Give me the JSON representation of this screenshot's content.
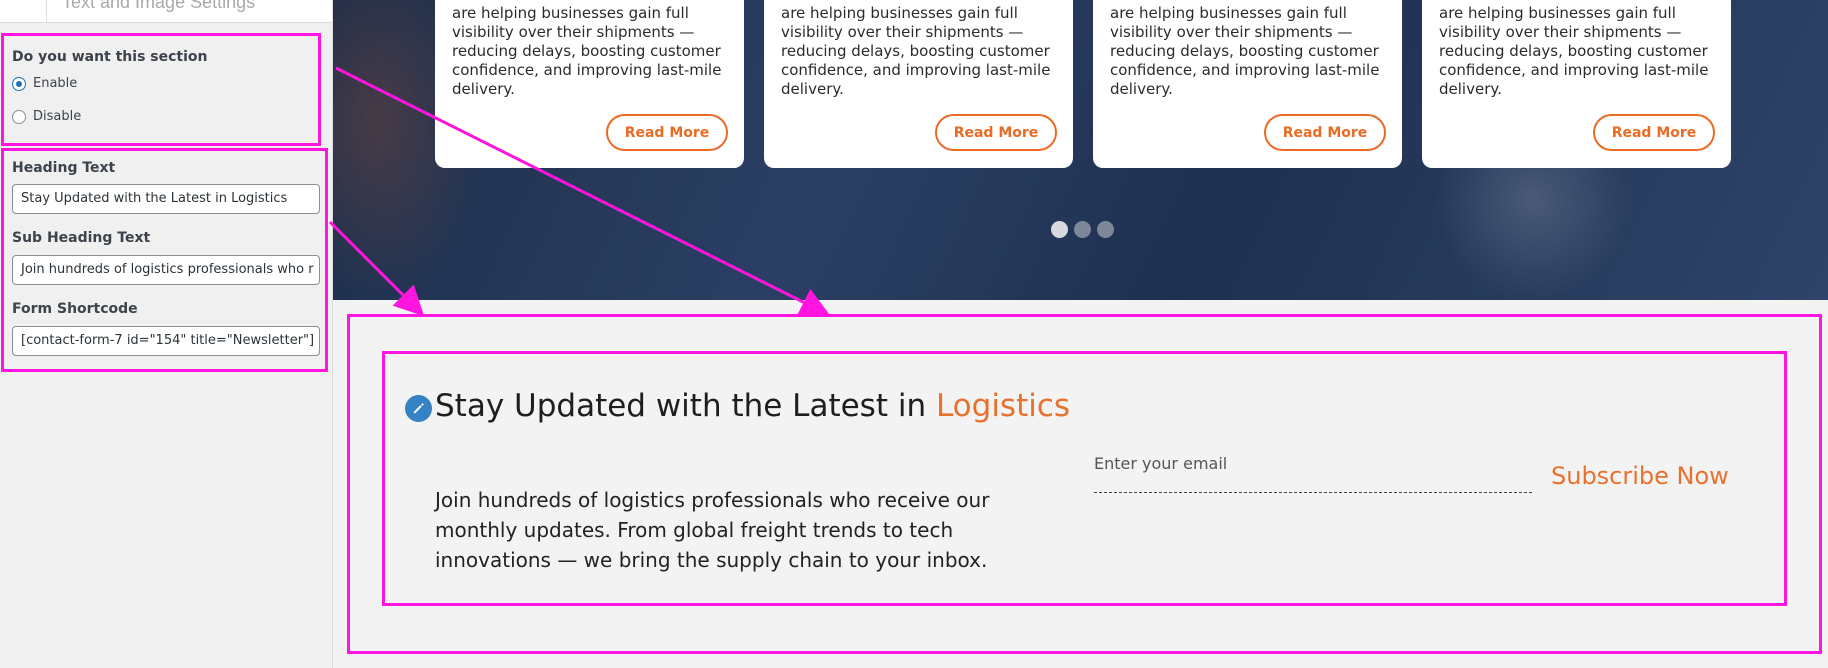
{
  "panel": {
    "section_title": "Text and Image Settings",
    "enable_label": "Do you want this section",
    "options": [
      {
        "label": "Enable",
        "checked": true
      },
      {
        "label": "Disable",
        "checked": false
      }
    ],
    "heading_label": "Heading Text",
    "heading_value": "Stay Updated with the Latest in Logistics",
    "subheading_label": "Sub Heading Text",
    "subheading_value": "Join hundreds of logistics professionals who r",
    "shortcode_label": "Form Shortcode",
    "shortcode_value": "[contact-form-7 id=\"154\" title=\"Newsletter\"]"
  },
  "hero": {
    "card_text": "are helping businesses gain full visibility over their shipments — reducing delays, boosting customer confidence, and improving last-mile delivery.",
    "read_more": "Read More",
    "slider_dots": 3,
    "active_dot": 0
  },
  "newsletter": {
    "title_main": "Stay Updated with the Latest in ",
    "title_accent": "Logistics",
    "subtitle": "Join hundreds of logistics professionals who receive our monthly updates.  From global freight trends to tech innovations — we bring the supply chain to your inbox.",
    "email_placeholder": "Enter your email",
    "subscribe_label": "Subscribe Now"
  },
  "colors": {
    "accent": "#e8722d",
    "highlight": "#ff14e0",
    "wp_blue": "#2271b1"
  }
}
